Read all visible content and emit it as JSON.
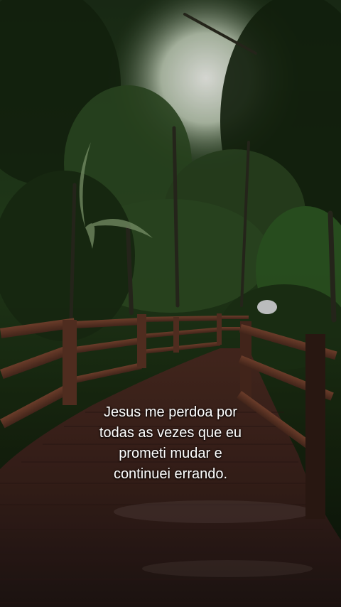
{
  "caption": {
    "lines": [
      "Jesus me perdoa por",
      "todas as vezes que eu",
      "prometi mudar e",
      "continuei errando."
    ],
    "color": "#ffffff"
  },
  "scene": {
    "subject": "forest-boardwalk-photo",
    "sky_color": "#dfe6dc",
    "foliage_color": "#1e3418",
    "deck_color": "#3a211b",
    "railing_color": "#6b3b28"
  }
}
